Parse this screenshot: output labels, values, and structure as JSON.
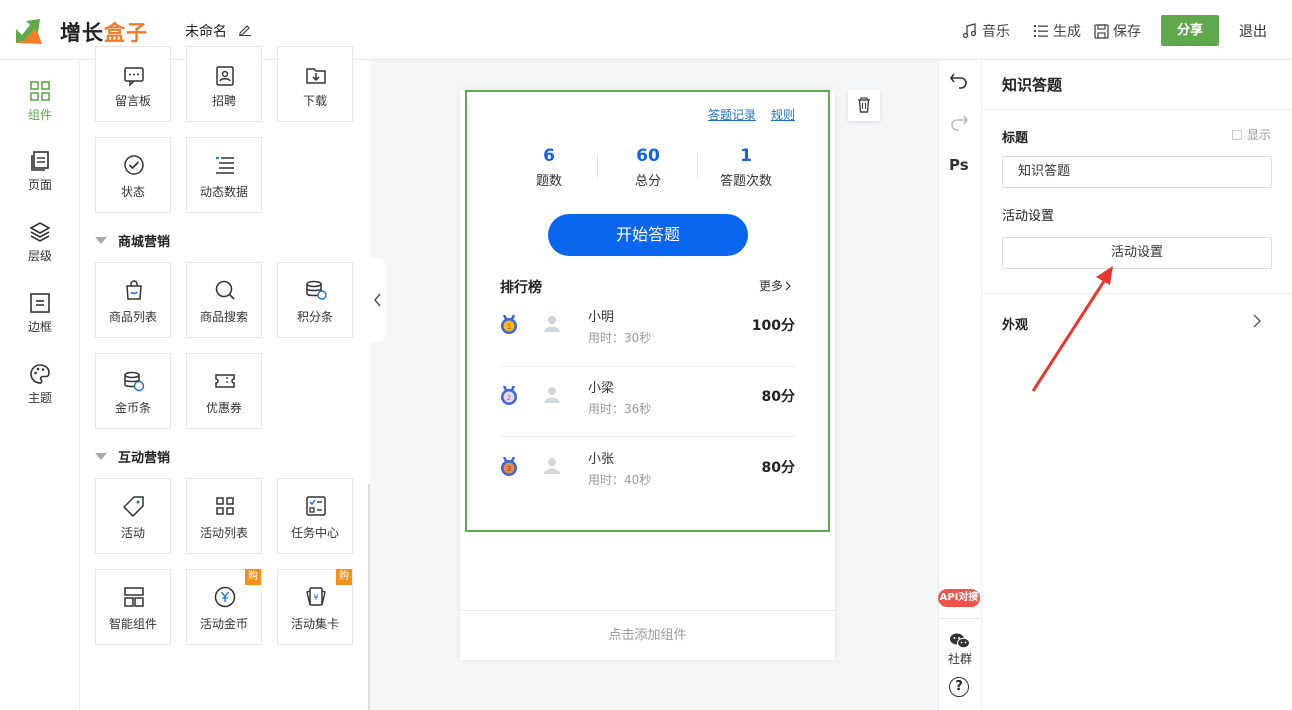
{
  "header": {
    "logo_text_a": "增长",
    "logo_text_b": "盒子",
    "doc_name": "未命名",
    "music": "音乐",
    "generate": "生成",
    "save": "保存",
    "share": "分享",
    "exit": "退出",
    "brand_green": "#5fa84b",
    "brand_orange": "#f37b28"
  },
  "left_nav": [
    {
      "label": "组件",
      "icon": "grid-icon"
    },
    {
      "label": "页面",
      "icon": "pages-icon"
    },
    {
      "label": "层级",
      "icon": "layers-icon"
    },
    {
      "label": "边框",
      "icon": "border-icon"
    },
    {
      "label": "主题",
      "icon": "palette-icon"
    }
  ],
  "components": {
    "top": [
      "留言板",
      "招聘",
      "下载",
      "状态",
      "动态数据"
    ],
    "mall_title": "商城营销",
    "mall": [
      "商品列表",
      "商品搜索",
      "积分条",
      "金币条",
      "优惠券"
    ],
    "interactive_title": "互动营销",
    "interactive": [
      "活动",
      "活动列表",
      "任务中心",
      "智能组件",
      "活动金币",
      "活动集卡"
    ],
    "buy_badge": "购"
  },
  "quiz": {
    "links": [
      "答题记录",
      "规则"
    ],
    "stats": [
      {
        "value": "6",
        "label": "题数"
      },
      {
        "value": "60",
        "label": "总分"
      },
      {
        "value": "1",
        "label": "答题次数"
      }
    ],
    "start": "开始答题",
    "rank_title": "排行榜",
    "more": "更多",
    "rows": [
      {
        "name": "小明",
        "time": "用时：30秒",
        "score": "100分",
        "medal": "gold"
      },
      {
        "name": "小梁",
        "time": "用时：36秒",
        "score": "80分",
        "medal": "silver"
      },
      {
        "name": "小张",
        "time": "用时：40秒",
        "score": "80分",
        "medal": "bronze"
      }
    ],
    "add_component": "点击添加组件"
  },
  "tools": {
    "ps": "Ps",
    "api": "API对接",
    "group": "社群",
    "help": "?"
  },
  "right_panel": {
    "title": "知识答题",
    "field_label": "标题",
    "show_label": "显示",
    "title_value": "知识答题",
    "activity_label": "活动设置",
    "activity_button": "活动设置",
    "appearance": "外观"
  }
}
